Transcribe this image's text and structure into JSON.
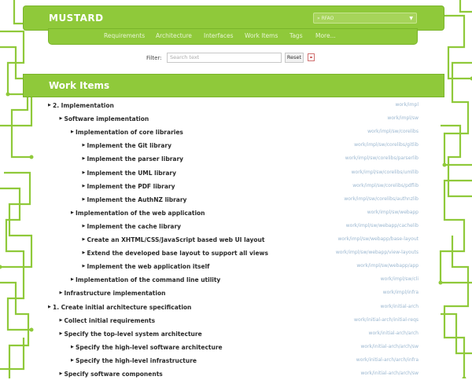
{
  "app": {
    "title": "MUSTARD"
  },
  "context_select": {
    "value": "» RFAO"
  },
  "nav": {
    "items": [
      "Requirements",
      "Architecture",
      "Interfaces",
      "Work Items",
      "Tags",
      "More..."
    ]
  },
  "filter": {
    "label": "Filter:",
    "placeholder": "Search text",
    "reset_label": "Reset"
  },
  "section": {
    "title": "Work Items"
  },
  "work_items": [
    {
      "label": "2. Implementation",
      "path": "work/impl",
      "level": 0
    },
    {
      "label": "Software implementation",
      "path": "work/impl/sw",
      "level": 1
    },
    {
      "label": "Implementation of core libraries",
      "path": "work/impl/sw/corelibs",
      "level": 2
    },
    {
      "label": "Implement the Git library",
      "path": "work/impl/sw/corelibs/gitlib",
      "level": 3
    },
    {
      "label": "Implement the parser library",
      "path": "work/impl/sw/corelibs/parserlib",
      "level": 3
    },
    {
      "label": "Implement the UML library",
      "path": "work/impl/sw/corelibs/umllib",
      "level": 3
    },
    {
      "label": "Implement the PDF library",
      "path": "work/impl/sw/corelibs/pdflib",
      "level": 3
    },
    {
      "label": "Implement the AuthNZ library",
      "path": "work/impl/sw/corelibs/authnzlib",
      "level": 3
    },
    {
      "label": "Implementation of the web application",
      "path": "work/impl/sw/webapp",
      "level": 2
    },
    {
      "label": "Implement the cache library",
      "path": "work/impl/sw/webapp/cachelib",
      "level": 3
    },
    {
      "label": "Create an XHTML/CSS/JavaScript based web UI layout",
      "path": "work/impl/sw/webapp/base-layout",
      "level": 3
    },
    {
      "label": "Extend the developed base layout to support all views",
      "path": "work/impl/sw/webapp/view-layouts",
      "level": 3
    },
    {
      "label": "Implement the web application itself",
      "path": "work/impl/sw/webapp/app",
      "level": 3
    },
    {
      "label": "Implementation of the command line utility",
      "path": "work/impl/sw/cli",
      "level": 2
    },
    {
      "label": "Infrastructure implementation",
      "path": "work/impl/infra",
      "level": 1
    },
    {
      "label": "1. Create initial architecture specification",
      "path": "work/initial-arch",
      "level": 0
    },
    {
      "label": "Collect initial requirements",
      "path": "work/initial-arch/initial-reqs",
      "level": 1
    },
    {
      "label": "Specify the top-level system architecture",
      "path": "work/initial-arch/arch",
      "level": 1
    },
    {
      "label": "Specify the high-level software architecture",
      "path": "work/initial-arch/arch/sw",
      "level": 2
    },
    {
      "label": "Specify the high-level infrastructure",
      "path": "work/initial-arch/arch/infra",
      "level": 2
    },
    {
      "label": "Specify software components",
      "path": "work/initial-arch/arch/sw",
      "level": 1
    }
  ]
}
